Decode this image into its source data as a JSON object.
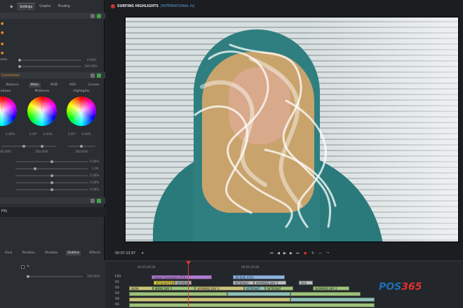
{
  "left_panel": {
    "tabs": [
      "Settings",
      "Graphs",
      "Routing"
    ],
    "rows_top": [
      {
        "label": "ness",
        "value": "0.00%"
      },
      {
        "label": "",
        "value": "100.00%"
      }
    ],
    "color_section_title": "Correction",
    "subtabs": [
      "Balance",
      "Main",
      "RGB",
      "HSV",
      "Curves"
    ],
    "wheels": [
      {
        "label": "adows",
        "values": [
          "",
          "0.00%"
        ],
        "pct": "00.00%"
      },
      {
        "label": "Midtones",
        "values": [
          "0.00°",
          "0.00%"
        ],
        "pct": "100.00%"
      },
      {
        "label": "Highlights",
        "values": [
          "0.00°",
          "0.00%"
        ],
        "pct": "100.00%"
      }
    ],
    "slider_values": [
      "0.00%",
      "1.00",
      "0.00%",
      "0.00%",
      "0.00%"
    ],
    "text_field": "FX)",
    "lower_tabs": [
      "Face",
      "Position",
      "Shadow",
      "Outline",
      "Effects"
    ],
    "lower_value": "100.00%"
  },
  "viewer": {
    "title": "SURFING HIGHLIGHTS",
    "subtitle": "[INTERNATIONAL fx]",
    "timecode": "00:07:23.87"
  },
  "timeline": {
    "ruler": [
      "00:05:00.00",
      "00:05:30.00"
    ],
    "tracks": [
      "FX1",
      "V1",
      "V2",
      "V3",
      "V4",
      "V5"
    ],
    "clips": [
      {
        "text": "Colour Correction (FX2)",
        "kind": "purple"
      },
      {
        "text": "3D DVE (FX2)",
        "kind": "blue"
      },
      {
        "text": "INTERNATIONAL",
        "kind": "yellow"
      },
      {
        "text": "WOMENS DAY 2",
        "kind": "gray"
      },
      {
        "text": "INTERNAT",
        "kind": "gray"
      },
      {
        "text": "WOMENS DAY 2",
        "kind": "gray"
      },
      {
        "text": "WOMENS DAY 3",
        "kind": "olive"
      },
      {
        "text": "WOM",
        "kind": "gray"
      },
      {
        "text": "MENS DAY 3",
        "kind": "green"
      },
      {
        "text": "INTERNAT",
        "kind": "teal"
      },
      {
        "text": "WOMENS DAY 2",
        "kind": "green"
      },
      {
        "text": "DVE",
        "kind": "gray"
      }
    ]
  },
  "watermark": {
    "part1": "POS",
    "part2": "365"
  },
  "colors": {
    "accent": "#e08a2c",
    "playhead": "#e03a2f",
    "title_blue": "#5b9bd5"
  }
}
